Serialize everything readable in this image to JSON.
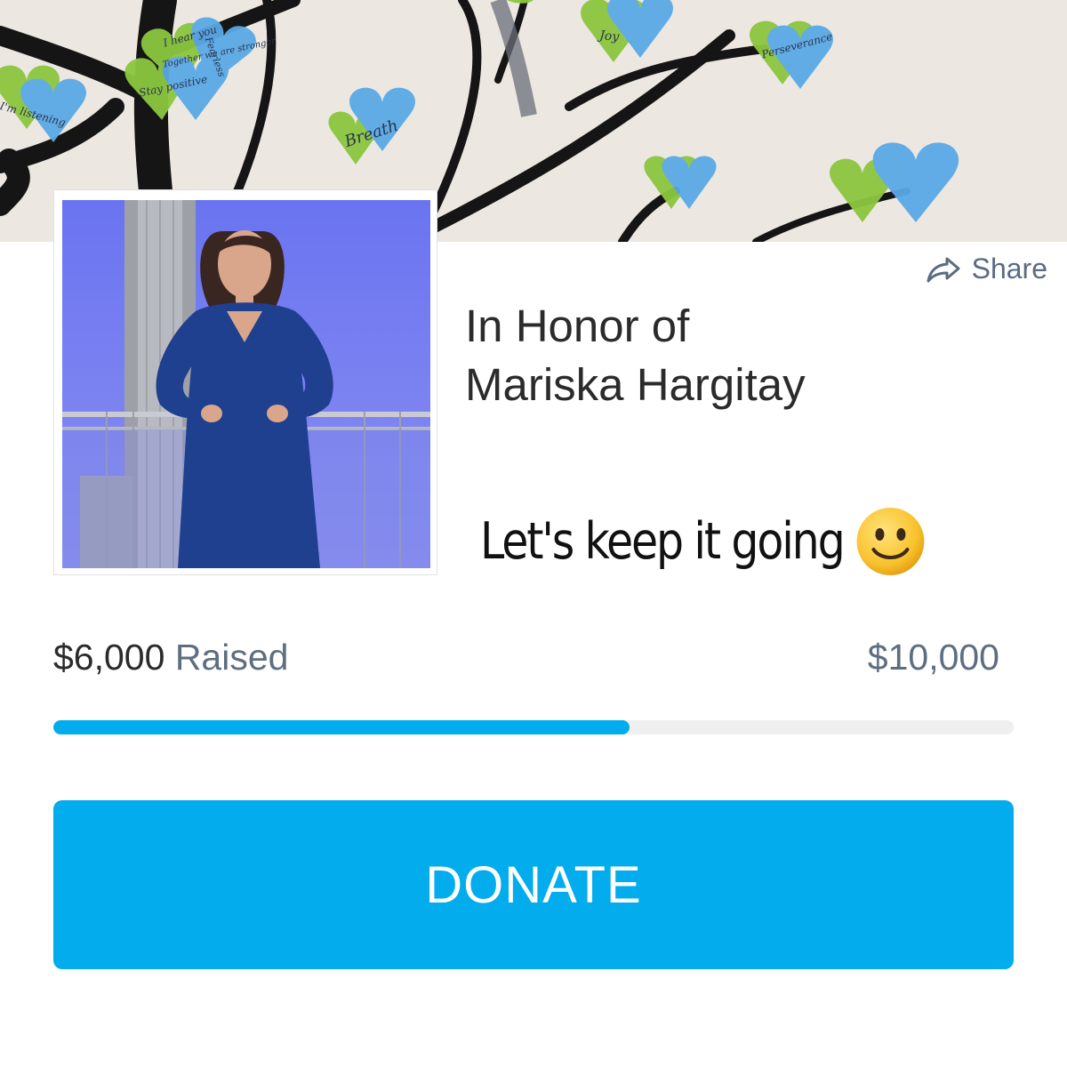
{
  "cover": {
    "notes": [
      "I hear you",
      "Together we are stronger",
      "Fearless",
      "Stay positive",
      "I'm listening",
      "Breath",
      "Joy",
      "Perseverance"
    ]
  },
  "share": {
    "label": "Share",
    "icon": "share-arrow-icon"
  },
  "campaign": {
    "title_line1": "In Honor of",
    "title_line2": "Mariska Hargitay",
    "tagline": "Let's keep it going",
    "tagline_emoji": "smiling-face-icon"
  },
  "progress": {
    "raised_amount": "$6,000",
    "raised_label": "Raised",
    "goal": "$10,000",
    "fraction": 0.6
  },
  "donate": {
    "label": "DONATE"
  },
  "colors": {
    "accent": "#02aced",
    "muted_text": "#5e6e82"
  }
}
